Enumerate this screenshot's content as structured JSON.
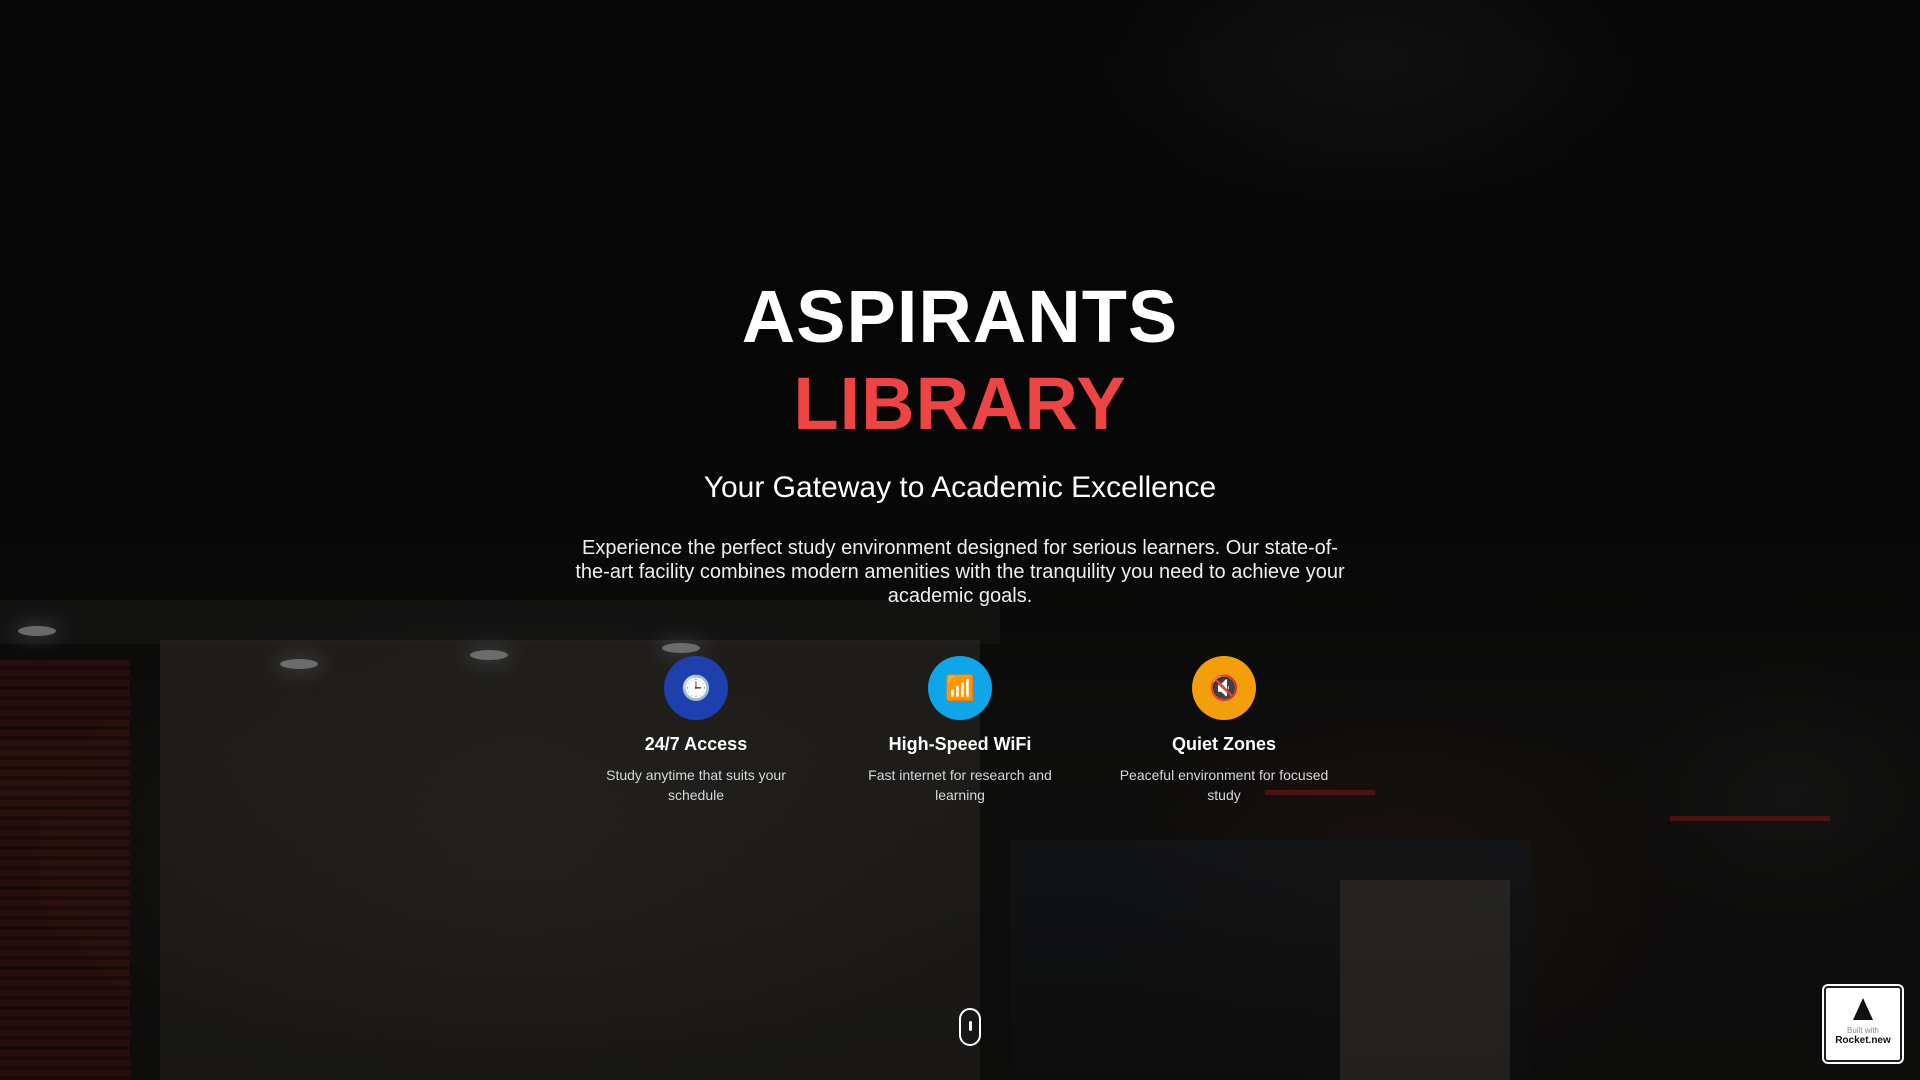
{
  "hero": {
    "title_line1": "ASPIRANTS",
    "title_line2": "LIBRARY",
    "subtitle": "Your Gateway to Academic Excellence",
    "description": "Experience the perfect study environment designed for serious learners. Our state-of-the-art facility combines modern amenities with the tranquility you need to achieve your academic goals.",
    "accent_color": "#ef4444"
  },
  "features": [
    {
      "icon": "clock-icon",
      "glyph": "🕒",
      "color": "#1e40af",
      "title": "24/7 Access",
      "description": "Study anytime that suits your schedule"
    },
    {
      "icon": "signal-bars-icon",
      "glyph": "📶",
      "color": "#0ea5e9",
      "title": "High-Speed WiFi",
      "description": "Fast internet for research and learning"
    },
    {
      "icon": "muted-speaker-icon",
      "glyph": "🔇",
      "color": "#f59e0b",
      "title": "Quiet Zones",
      "description": "Peaceful environment for focused study"
    }
  ],
  "badge": {
    "small_text": "Built with",
    "brand": "Rocket.new"
  }
}
